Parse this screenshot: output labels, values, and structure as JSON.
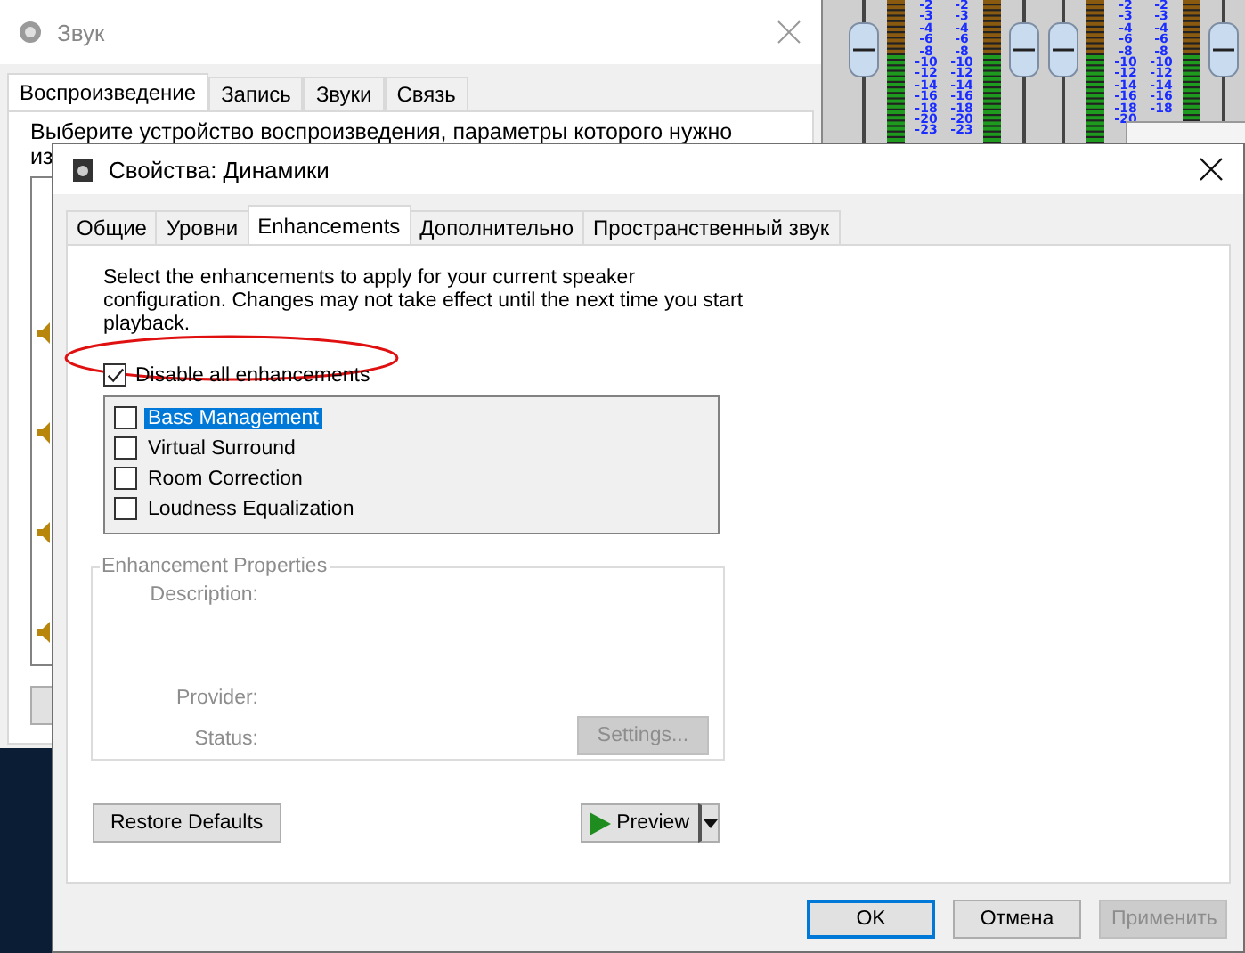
{
  "back_window": {
    "title": "Звук",
    "tabs": [
      {
        "label": "Воспроизведение",
        "selected": true
      },
      {
        "label": "Запись",
        "selected": false
      },
      {
        "label": "Звуки",
        "selected": false
      },
      {
        "label": "Связь",
        "selected": false
      }
    ],
    "instruction": "Выберите устройство воспроизведения, параметры которого нужно",
    "instruction_cont": "из"
  },
  "mixer": {
    "scales": [
      {
        "labels": [
          "-2",
          "-3",
          "-4",
          "-6",
          "-8",
          "-10",
          "-12",
          "-14",
          "-16",
          "-18",
          "-20",
          "-23"
        ]
      },
      {
        "labels": [
          "-2",
          "-3",
          "-4",
          "-6",
          "-8",
          "-10",
          "-12",
          "-14",
          "-16",
          "-18",
          "-20",
          "-23"
        ]
      },
      {
        "labels": [
          "-2",
          "-3",
          "-4",
          "-6",
          "-8",
          "-10",
          "-12",
          "-14",
          "-16",
          "-18",
          "-20"
        ]
      },
      {
        "labels": [
          "-2",
          "-3",
          "-4",
          "-6",
          "-8",
          "-10",
          "-12",
          "-14",
          "-16",
          "-18"
        ]
      }
    ]
  },
  "dialog": {
    "title": "Свойства: Динамики",
    "tabs": [
      {
        "label": "Общие",
        "selected": false
      },
      {
        "label": "Уровни",
        "selected": false
      },
      {
        "label": "Enhancements",
        "selected": true
      },
      {
        "label": "Дополнительно",
        "selected": false
      },
      {
        "label": "Пространственный звук",
        "selected": false
      }
    ],
    "description": "Select the enhancements to apply for your current speaker configuration. Changes may not take effect until the next time you start playback.",
    "disable_all": {
      "label": "Disable all enhancements",
      "checked": true
    },
    "enhancements": [
      {
        "label": "Bass Management",
        "checked": false,
        "selected": true
      },
      {
        "label": "Virtual Surround",
        "checked": false,
        "selected": false
      },
      {
        "label": "Room Correction",
        "checked": false,
        "selected": false
      },
      {
        "label": "Loudness Equalization",
        "checked": false,
        "selected": false
      }
    ],
    "properties": {
      "title": "Enhancement Properties",
      "disabled": true,
      "fields": [
        "Description:",
        "Provider:",
        "Status:"
      ],
      "settings_button": {
        "label": "Settings...",
        "disabled": true
      }
    },
    "restore_defaults": "Restore Defaults",
    "preview": "Preview",
    "buttons": [
      {
        "label": "OK",
        "kind": "default",
        "disabled": false
      },
      {
        "label": "Отмена",
        "kind": "normal",
        "disabled": false
      },
      {
        "label": "Применить",
        "kind": "normal",
        "disabled": true
      }
    ]
  }
}
